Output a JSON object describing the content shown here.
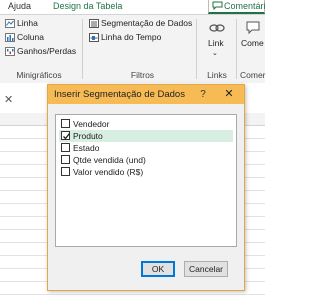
{
  "tabs": {
    "help": "Ajuda",
    "design": "Design da Tabela",
    "comments": "Comentári"
  },
  "ribbon": {
    "sparklines": {
      "line": "Linha",
      "column": "Coluna",
      "win_loss": "Ganhos/Perdas",
      "group": "Minigráficos"
    },
    "filters": {
      "slicer": "Segmentação de Dados",
      "timeline": "Linha do Tempo",
      "group": "Filtros"
    },
    "links": {
      "link": "Link",
      "group": "Links"
    },
    "comment": {
      "label": "Come",
      "group": "Comer"
    }
  },
  "sheet": {
    "cancel_glyph": "✕"
  },
  "dialog": {
    "title": "Inserir Segmentação de Dados",
    "help": "?",
    "close": "✕",
    "fields": [
      {
        "label": "Vendedor",
        "checked": false
      },
      {
        "label": "Produto",
        "checked": true
      },
      {
        "label": "Estado",
        "checked": false
      },
      {
        "label": "Qtde vendida (und)",
        "checked": false
      },
      {
        "label": "Valor vendido (R$)",
        "checked": false
      }
    ],
    "ok": "OK",
    "cancel": "Cancelar"
  },
  "colors": {
    "accent": "#217346",
    "dialog_title": "#f7bb55",
    "selection": "#d9eee2"
  }
}
